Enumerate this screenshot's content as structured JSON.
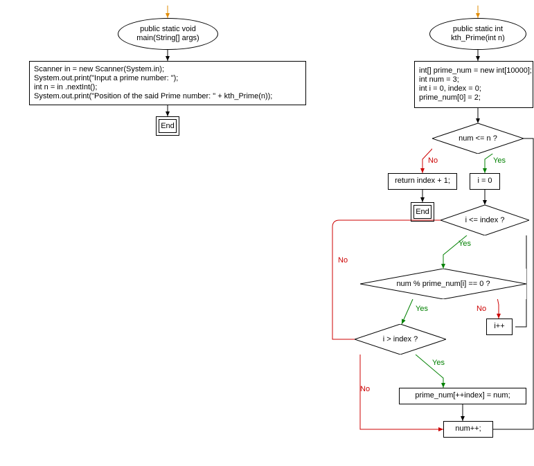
{
  "chart_data": {
    "type": "flowchart",
    "functions": [
      {
        "name": "main",
        "signature": "public static void\nmain(String[] args)",
        "body": "Scanner in = new Scanner(System.in);\nSystem.out.print(\"Input a prime number: \");\nint n = in .nextInt();\nSystem.out.print(\"Position of the said Prime number: \" + kth_Prime(n));",
        "end": "End"
      },
      {
        "name": "kth_Prime",
        "signature": "public static int\nkth_Prime(int n)",
        "init": "int[] prime_num = new int[10000];\nint num = 3;\nint i = 0, index = 0;\nprime_num[0] = 2;",
        "cond_outer": "num <= n ?",
        "outer_no": "return index + 1;",
        "outer_yes": "i = 0",
        "cond_inner": "i <= index ?",
        "cond_mod": "num % prime_num[i] == 0 ?",
        "inc_i": "i++",
        "cond_after": "i > index ?",
        "store_prime": "prime_num[++index] = num;",
        "inc_num": "num++;",
        "end": "End",
        "labels": {
          "yes": "Yes",
          "no": "No"
        }
      }
    ]
  },
  "left": {
    "sig": "public static void\nmain(String[] args)",
    "body": "Scanner in = new Scanner(System.in);\nSystem.out.print(\"Input a prime number: \");\nint n = in .nextInt();\nSystem.out.print(\"Position of the said Prime number: \" + kth_Prime(n));",
    "end": "End"
  },
  "right": {
    "sig": "public static int\nkth_Prime(int n)",
    "init": "int[] prime_num = new int[10000];\nint num = 3;\nint i = 0, index = 0;\nprime_num[0] = 2;",
    "cond1": "num <= n ?",
    "ret": "return index + 1;",
    "i0": "i = 0",
    "cond2": "i <= index ?",
    "cond3": "num % prime_num[i] == 0 ?",
    "ipp": "i++",
    "cond4": "i > index ?",
    "store": "prime_num[++index] = num;",
    "numpp": "num++;",
    "end": "End",
    "yes": "Yes",
    "no": "No"
  }
}
